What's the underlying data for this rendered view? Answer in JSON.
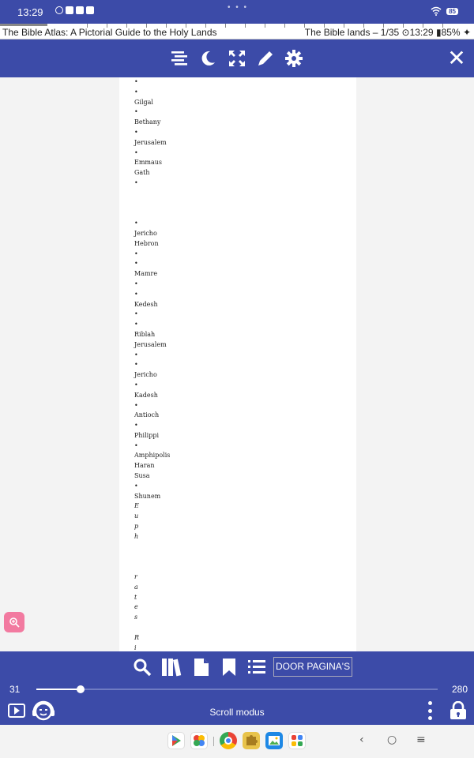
{
  "status": {
    "time": "13:29",
    "battery": "85"
  },
  "reader_info": {
    "book_title": "The Bible Atlas: A Pictorial Guide to the Holy Lands",
    "chapter_info": "The Bible lands – 1/35",
    "clock": "13:29",
    "battery": "85%",
    "chapter_progress": 0.1
  },
  "toolbar": {
    "icons": [
      "text-align-icon",
      "night-mode-icon",
      "fullscreen-icon",
      "pen-icon",
      "settings-icon",
      "close-icon"
    ]
  },
  "page_lines": [
    {
      "text": "•"
    },
    {
      "text": "•"
    },
    {
      "text": "Gilgal"
    },
    {
      "text": "•"
    },
    {
      "text": "Bethany"
    },
    {
      "text": "•"
    },
    {
      "text": "Jerusalem"
    },
    {
      "text": "•"
    },
    {
      "text": "Emmaus"
    },
    {
      "text": "Gath"
    },
    {
      "text": "•"
    },
    {
      "text": ""
    },
    {
      "text": ""
    },
    {
      "text": ""
    },
    {
      "text": "•"
    },
    {
      "text": "Jericho"
    },
    {
      "text": "Hebron"
    },
    {
      "text": "•"
    },
    {
      "text": "•"
    },
    {
      "text": "Mamre"
    },
    {
      "text": "•"
    },
    {
      "text": "•"
    },
    {
      "text": "Kedesh"
    },
    {
      "text": "•"
    },
    {
      "text": "•"
    },
    {
      "text": "Riblah"
    },
    {
      "text": "Jerusalem"
    },
    {
      "text": "•"
    },
    {
      "text": "•"
    },
    {
      "text": "Jericho"
    },
    {
      "text": "•"
    },
    {
      "text": "Kadesh"
    },
    {
      "text": "•"
    },
    {
      "text": "Antioch"
    },
    {
      "text": "•"
    },
    {
      "text": "Philippi"
    },
    {
      "text": "•"
    },
    {
      "text": "Amphipolis"
    },
    {
      "text": "Haran"
    },
    {
      "text": "Susa"
    },
    {
      "text": "•"
    },
    {
      "text": "Shunem"
    },
    {
      "text": "E",
      "italic": true
    },
    {
      "text": "u",
      "italic": true
    },
    {
      "text": "p",
      "italic": true
    },
    {
      "text": "h",
      "italic": true
    },
    {
      "text": ""
    },
    {
      "text": ""
    },
    {
      "text": ""
    },
    {
      "text": "r",
      "italic": true
    },
    {
      "text": "a",
      "italic": true
    },
    {
      "text": "t",
      "italic": true
    },
    {
      "text": "e",
      "italic": true
    },
    {
      "text": "s",
      "italic": true
    },
    {
      "text": ""
    },
    {
      "text": "R",
      "italic": true
    },
    {
      "text": "i",
      "italic": true
    }
  ],
  "bottom": {
    "nav_pages_label": "DOOR PAGINA'S",
    "current_page": "31",
    "total_pages": "280",
    "progress": 0.11,
    "mode_label": "Scroll modus"
  },
  "dock": {
    "apps": [
      "play-store-icon",
      "photos-icon",
      "chrome-icon",
      "puzzle-game-icon",
      "gallery-icon",
      "app-drawer-icon"
    ],
    "nav": [
      "back-icon",
      "home-icon",
      "recents-icon"
    ]
  }
}
